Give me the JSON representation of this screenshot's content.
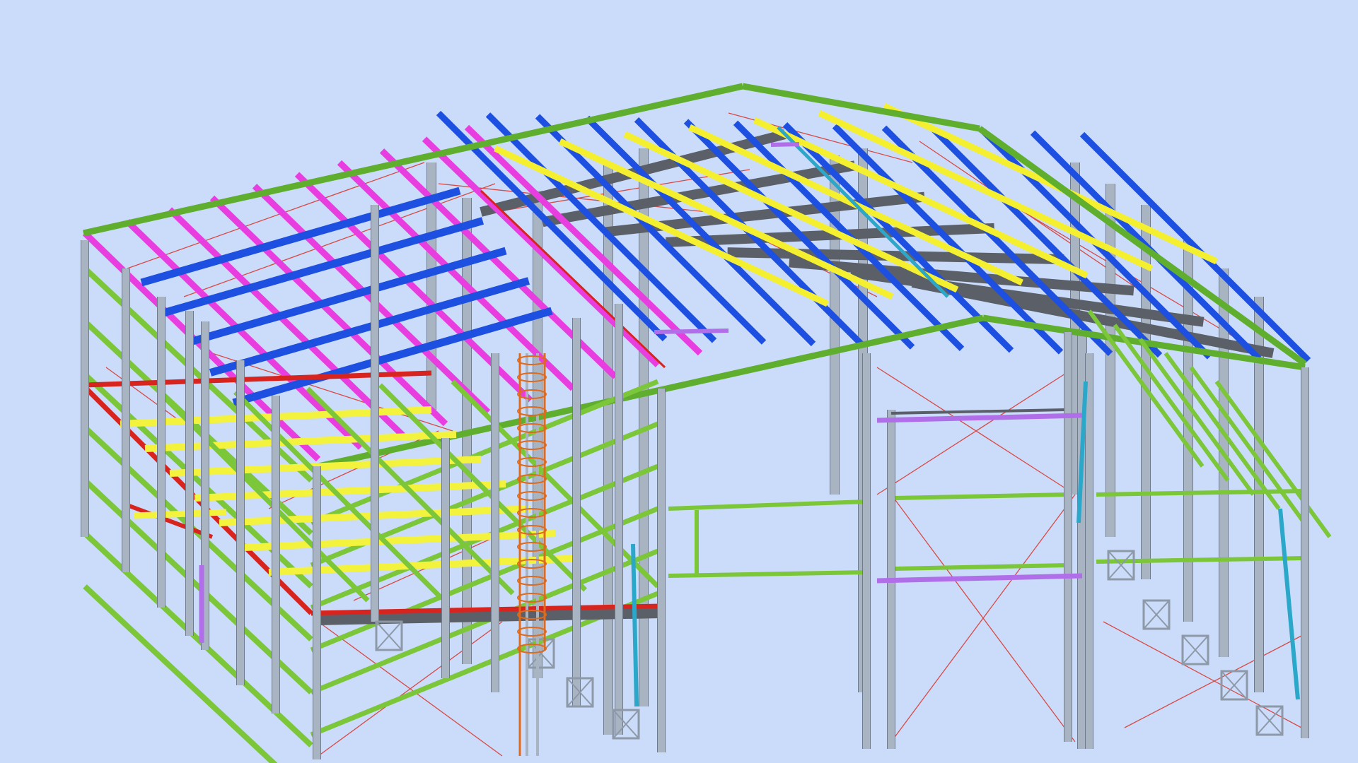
{
  "colors": {
    "background": "#cbdcfb",
    "column": "#a9b4c3",
    "column_edge": "#6f7b8c",
    "eave_beam": "#5fae2e",
    "girt": "#7cc63a",
    "purlin_magenta": "#e83ee0",
    "purlin_blue": "#1d4fe0",
    "rafter_dark": "#5b5f68",
    "purlin_yellow": "#f4f030",
    "floor_edge_red": "#d8241f",
    "floor_beam_yellow": "#f3f23c",
    "bracing_red": "#d84a44",
    "ladder_orange": "#e06a1c",
    "door_violet": "#b06ee8",
    "brace_cyan": "#2aa7c9",
    "base_plate": "#8e99a8"
  },
  "icons": {
    "ladder": "cage-ladder-icon",
    "base": "column-base-icon"
  }
}
